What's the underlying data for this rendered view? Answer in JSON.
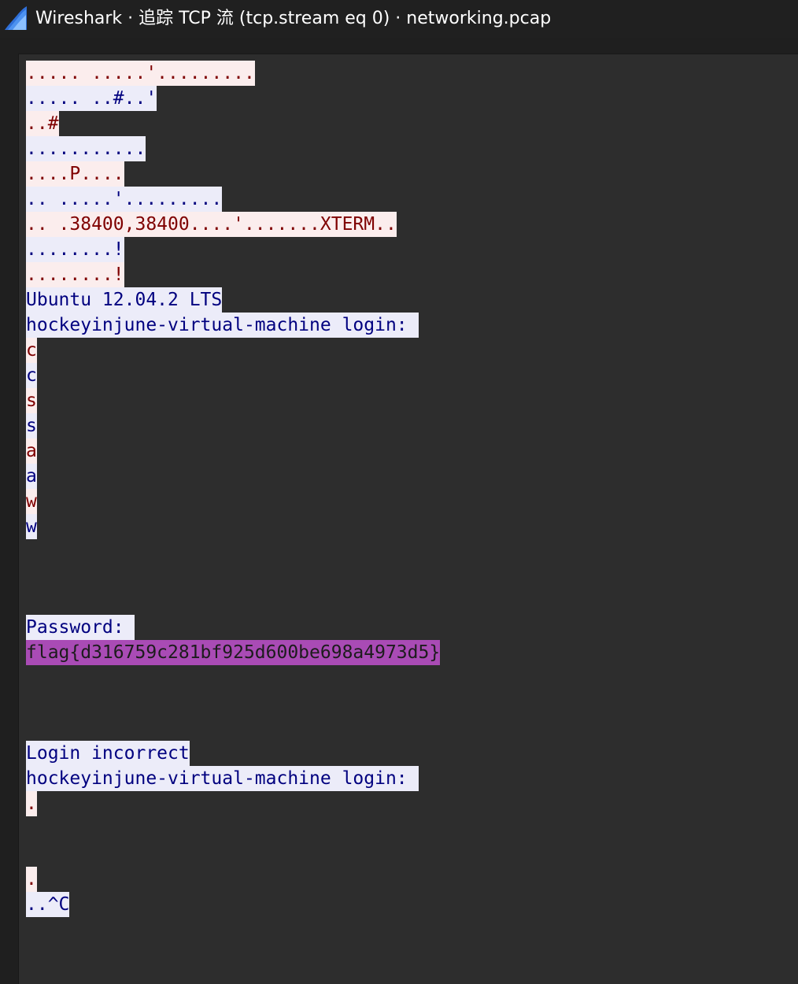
{
  "window": {
    "title": "Wireshark · 追踪 TCP 流 (tcp.stream eq 0) · networking.pcap",
    "icon": "wireshark-fin-icon"
  },
  "colors": {
    "client_bg": "#fbeded",
    "client_fg": "#7f0000",
    "server_bg": "#ececf9",
    "server_fg": "#00007f",
    "highlight_bg": "#a94bb5"
  },
  "stream": {
    "lines": [
      {
        "dir": "client",
        "text": "..... .....'........."
      },
      {
        "dir": "server",
        "text": "..... ..#..'"
      },
      {
        "dir": "client",
        "text": "..#"
      },
      {
        "dir": "server",
        "text": "..........."
      },
      {
        "dir": "client",
        "text": "....P...."
      },
      {
        "dir": "server",
        "text": ".. .....'........."
      },
      {
        "dir": "client",
        "text": ".. .38400,38400....'.......XTERM.."
      },
      {
        "dir": "server",
        "text": "........!"
      },
      {
        "dir": "client",
        "text": "........!"
      },
      {
        "dir": "server",
        "text": "Ubuntu 12.04.2 LTS"
      },
      {
        "dir": "server",
        "text": "hockeyinjune-virtual-machine login: "
      },
      {
        "dir": "client",
        "text": "c"
      },
      {
        "dir": "server",
        "text": "c"
      },
      {
        "dir": "client",
        "text": "s"
      },
      {
        "dir": "server",
        "text": "s"
      },
      {
        "dir": "client",
        "text": "a"
      },
      {
        "dir": "server",
        "text": "a"
      },
      {
        "dir": "client",
        "text": "w"
      },
      {
        "dir": "server",
        "text": "w"
      },
      {
        "dir": "blank",
        "text": ""
      },
      {
        "dir": "blank",
        "text": ""
      },
      {
        "dir": "blank",
        "text": ""
      },
      {
        "dir": "server",
        "text": "Password: "
      },
      {
        "dir": "highlight",
        "text": "flag{d316759c281bf925d600be698a4973d5}"
      },
      {
        "dir": "blank",
        "text": ""
      },
      {
        "dir": "blank",
        "text": ""
      },
      {
        "dir": "blank",
        "text": ""
      },
      {
        "dir": "server",
        "text": "Login incorrect"
      },
      {
        "dir": "server",
        "text": "hockeyinjune-virtual-machine login: "
      },
      {
        "dir": "client",
        "text": "."
      },
      {
        "dir": "blank",
        "text": ""
      },
      {
        "dir": "blank",
        "text": ""
      },
      {
        "dir": "client",
        "text": "."
      },
      {
        "dir": "server",
        "text": "..^C"
      }
    ]
  }
}
